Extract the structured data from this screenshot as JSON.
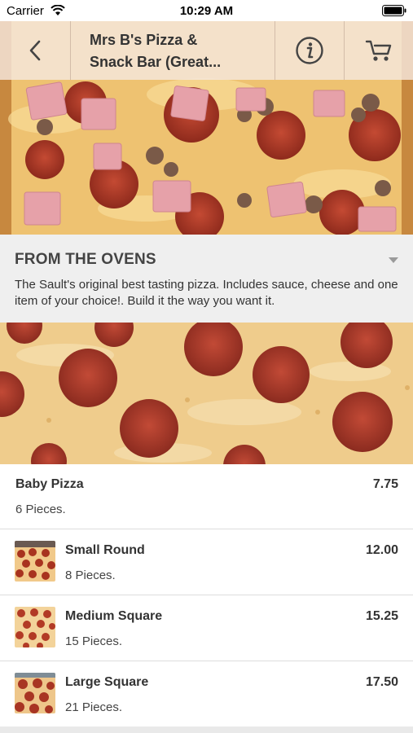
{
  "status_bar": {
    "carrier": "Carrier",
    "time": "10:29 AM"
  },
  "header": {
    "title_line1": "Mrs B's Pizza &",
    "title_line2": "Snack Bar (Great...",
    "icons": [
      "back-chevron-icon",
      "info-icon",
      "cart-icon"
    ]
  },
  "category": {
    "title": "FROM THE OVENS",
    "description": "The Sault's original best tasting pizza. Includes sauce, cheese and one item of your choice!. Build it the way you want it."
  },
  "menu_items": [
    {
      "name": "Baby Pizza",
      "description": "6 Pieces.",
      "price": "7.75",
      "has_image": false
    },
    {
      "name": "Small Round",
      "description": "8 Pieces.",
      "price": "12.00",
      "has_image": true
    },
    {
      "name": "Medium Square",
      "description": "15 Pieces.",
      "price": "15.25",
      "has_image": true
    },
    {
      "name": "Large Square",
      "description": "21 Pieces.",
      "price": "17.50",
      "has_image": true
    }
  ],
  "colors": {
    "nav_background": "#f5e8de",
    "category_background": "#efefef",
    "pepperoni": "#b03a2e",
    "ham": "#e8a0a6",
    "cheese": "#f6d183"
  }
}
